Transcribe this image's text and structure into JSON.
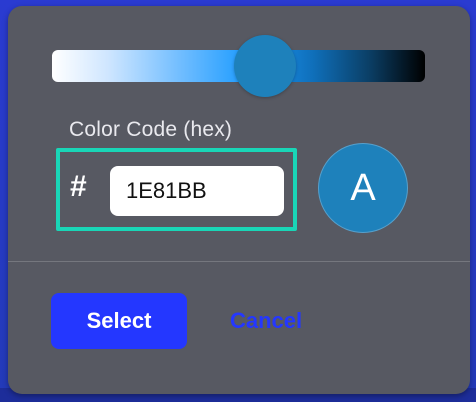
{
  "picker": {
    "label": "Color Code (hex)",
    "hash_symbol": "#",
    "hex_value": "1E81BB",
    "preview_letter": "A",
    "slider_value": 0.52
  },
  "actions": {
    "select_label": "Select",
    "cancel_label": "Cancel"
  },
  "colors": {
    "selected": "#1E81BB",
    "focus_outline": "#19D6B7",
    "primary_button": "#2437FF"
  }
}
